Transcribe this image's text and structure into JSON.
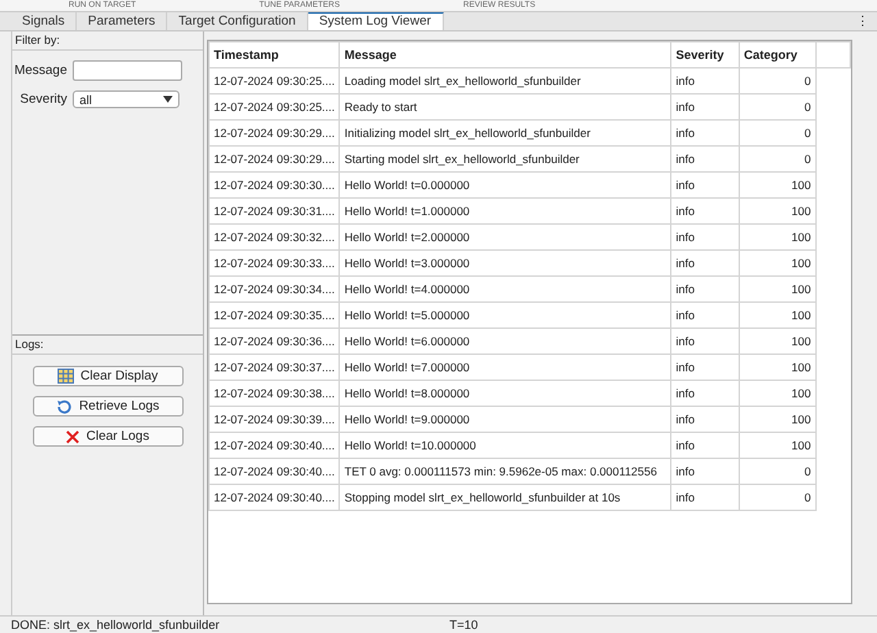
{
  "toolstrip_tabs": [
    "RUN ON TARGET",
    "TUNE PARAMETERS",
    "REVIEW RESULTS"
  ],
  "tabs": [
    {
      "label": "Signals",
      "selected": false
    },
    {
      "label": "Parameters",
      "selected": false
    },
    {
      "label": "Target Configuration",
      "selected": false
    },
    {
      "label": "System Log Viewer",
      "selected": true
    }
  ],
  "tab_menu": "⋮",
  "filter": {
    "title": "Filter by:",
    "message_label": "Message",
    "severity_label": "Severity",
    "severity_value": "all"
  },
  "logs": {
    "title": "Logs:",
    "buttons": [
      {
        "label": "Clear Display",
        "kind": "grid"
      },
      {
        "label": "Retrieve Logs",
        "kind": "refresh"
      },
      {
        "label": "Clear Logs",
        "kind": "cross"
      }
    ]
  },
  "table": {
    "columns": [
      "Timestamp",
      "Message",
      "Severity",
      "Category"
    ],
    "rows": [
      [
        "12-07-2024 09:30:25....",
        "Loading model slrt_ex_helloworld_sfunbuilder",
        "info",
        "0"
      ],
      [
        "12-07-2024 09:30:25....",
        "Ready to start",
        "info",
        "0"
      ],
      [
        "12-07-2024 09:30:29....",
        "Initializing model slrt_ex_helloworld_sfunbuilder",
        "info",
        "0"
      ],
      [
        "12-07-2024 09:30:29....",
        "Starting model slrt_ex_helloworld_sfunbuilder",
        "info",
        "0"
      ],
      [
        "12-07-2024 09:30:30....",
        "Hello World! t=0.000000",
        "info",
        "100"
      ],
      [
        "12-07-2024 09:30:31....",
        "Hello World! t=1.000000",
        "info",
        "100"
      ],
      [
        "12-07-2024 09:30:32....",
        "Hello World! t=2.000000",
        "info",
        "100"
      ],
      [
        "12-07-2024 09:30:33....",
        "Hello World! t=3.000000",
        "info",
        "100"
      ],
      [
        "12-07-2024 09:30:34....",
        "Hello World! t=4.000000",
        "info",
        "100"
      ],
      [
        "12-07-2024 09:30:35....",
        "Hello World! t=5.000000",
        "info",
        "100"
      ],
      [
        "12-07-2024 09:30:36....",
        "Hello World! t=6.000000",
        "info",
        "100"
      ],
      [
        "12-07-2024 09:30:37....",
        "Hello World! t=7.000000",
        "info",
        "100"
      ],
      [
        "12-07-2024 09:30:38....",
        "Hello World! t=8.000000",
        "info",
        "100"
      ],
      [
        "12-07-2024 09:30:39....",
        "Hello World! t=9.000000",
        "info",
        "100"
      ],
      [
        "12-07-2024 09:30:40....",
        "Hello World! t=10.000000",
        "info",
        "100"
      ],
      [
        "12-07-2024 09:30:40....",
        "TET 0 avg: 0.000111573 min: 9.5962e-05 max: 0.000112556",
        "info",
        "0"
      ],
      [
        "12-07-2024 09:30:40....",
        "Stopping model slrt_ex_helloworld_sfunbuilder at 10s",
        "info",
        "0"
      ]
    ]
  },
  "status_bar": {
    "message": "DONE: slrt_ex_helloworld_sfunbuilder",
    "time": "T=10"
  }
}
